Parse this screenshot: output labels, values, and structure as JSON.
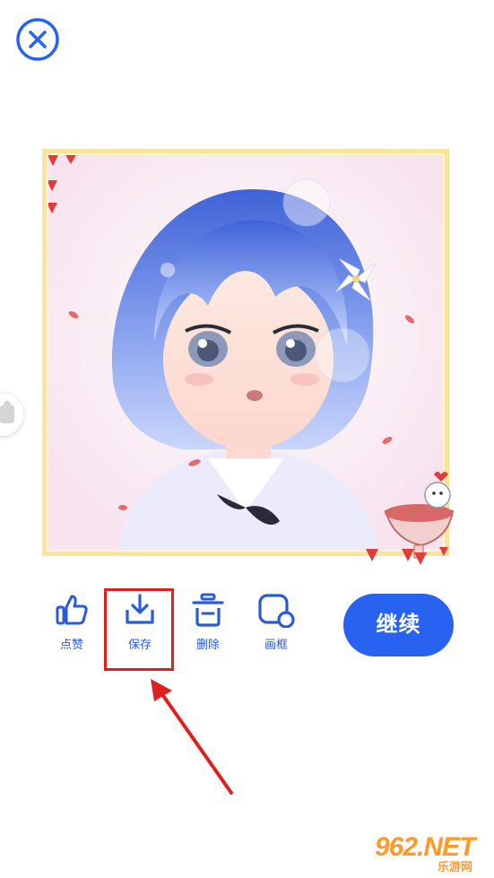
{
  "toolbar": {
    "like_label": "点赞",
    "save_label": "保存",
    "delete_label": "删除",
    "frame_label": "画框"
  },
  "continue_label": "继续",
  "watermark": {
    "brand": "962.NET",
    "sub": "乐游网"
  },
  "colors": {
    "accent": "#2762f0",
    "icon_blue": "#2a5bd7",
    "highlight_red": "#e0201f",
    "frame_yellow": "#f9e49b"
  },
  "icons": [
    "close-icon",
    "thumbs-up-icon",
    "download-icon",
    "trash-icon",
    "frame-icon",
    "puzzle-icon"
  ]
}
